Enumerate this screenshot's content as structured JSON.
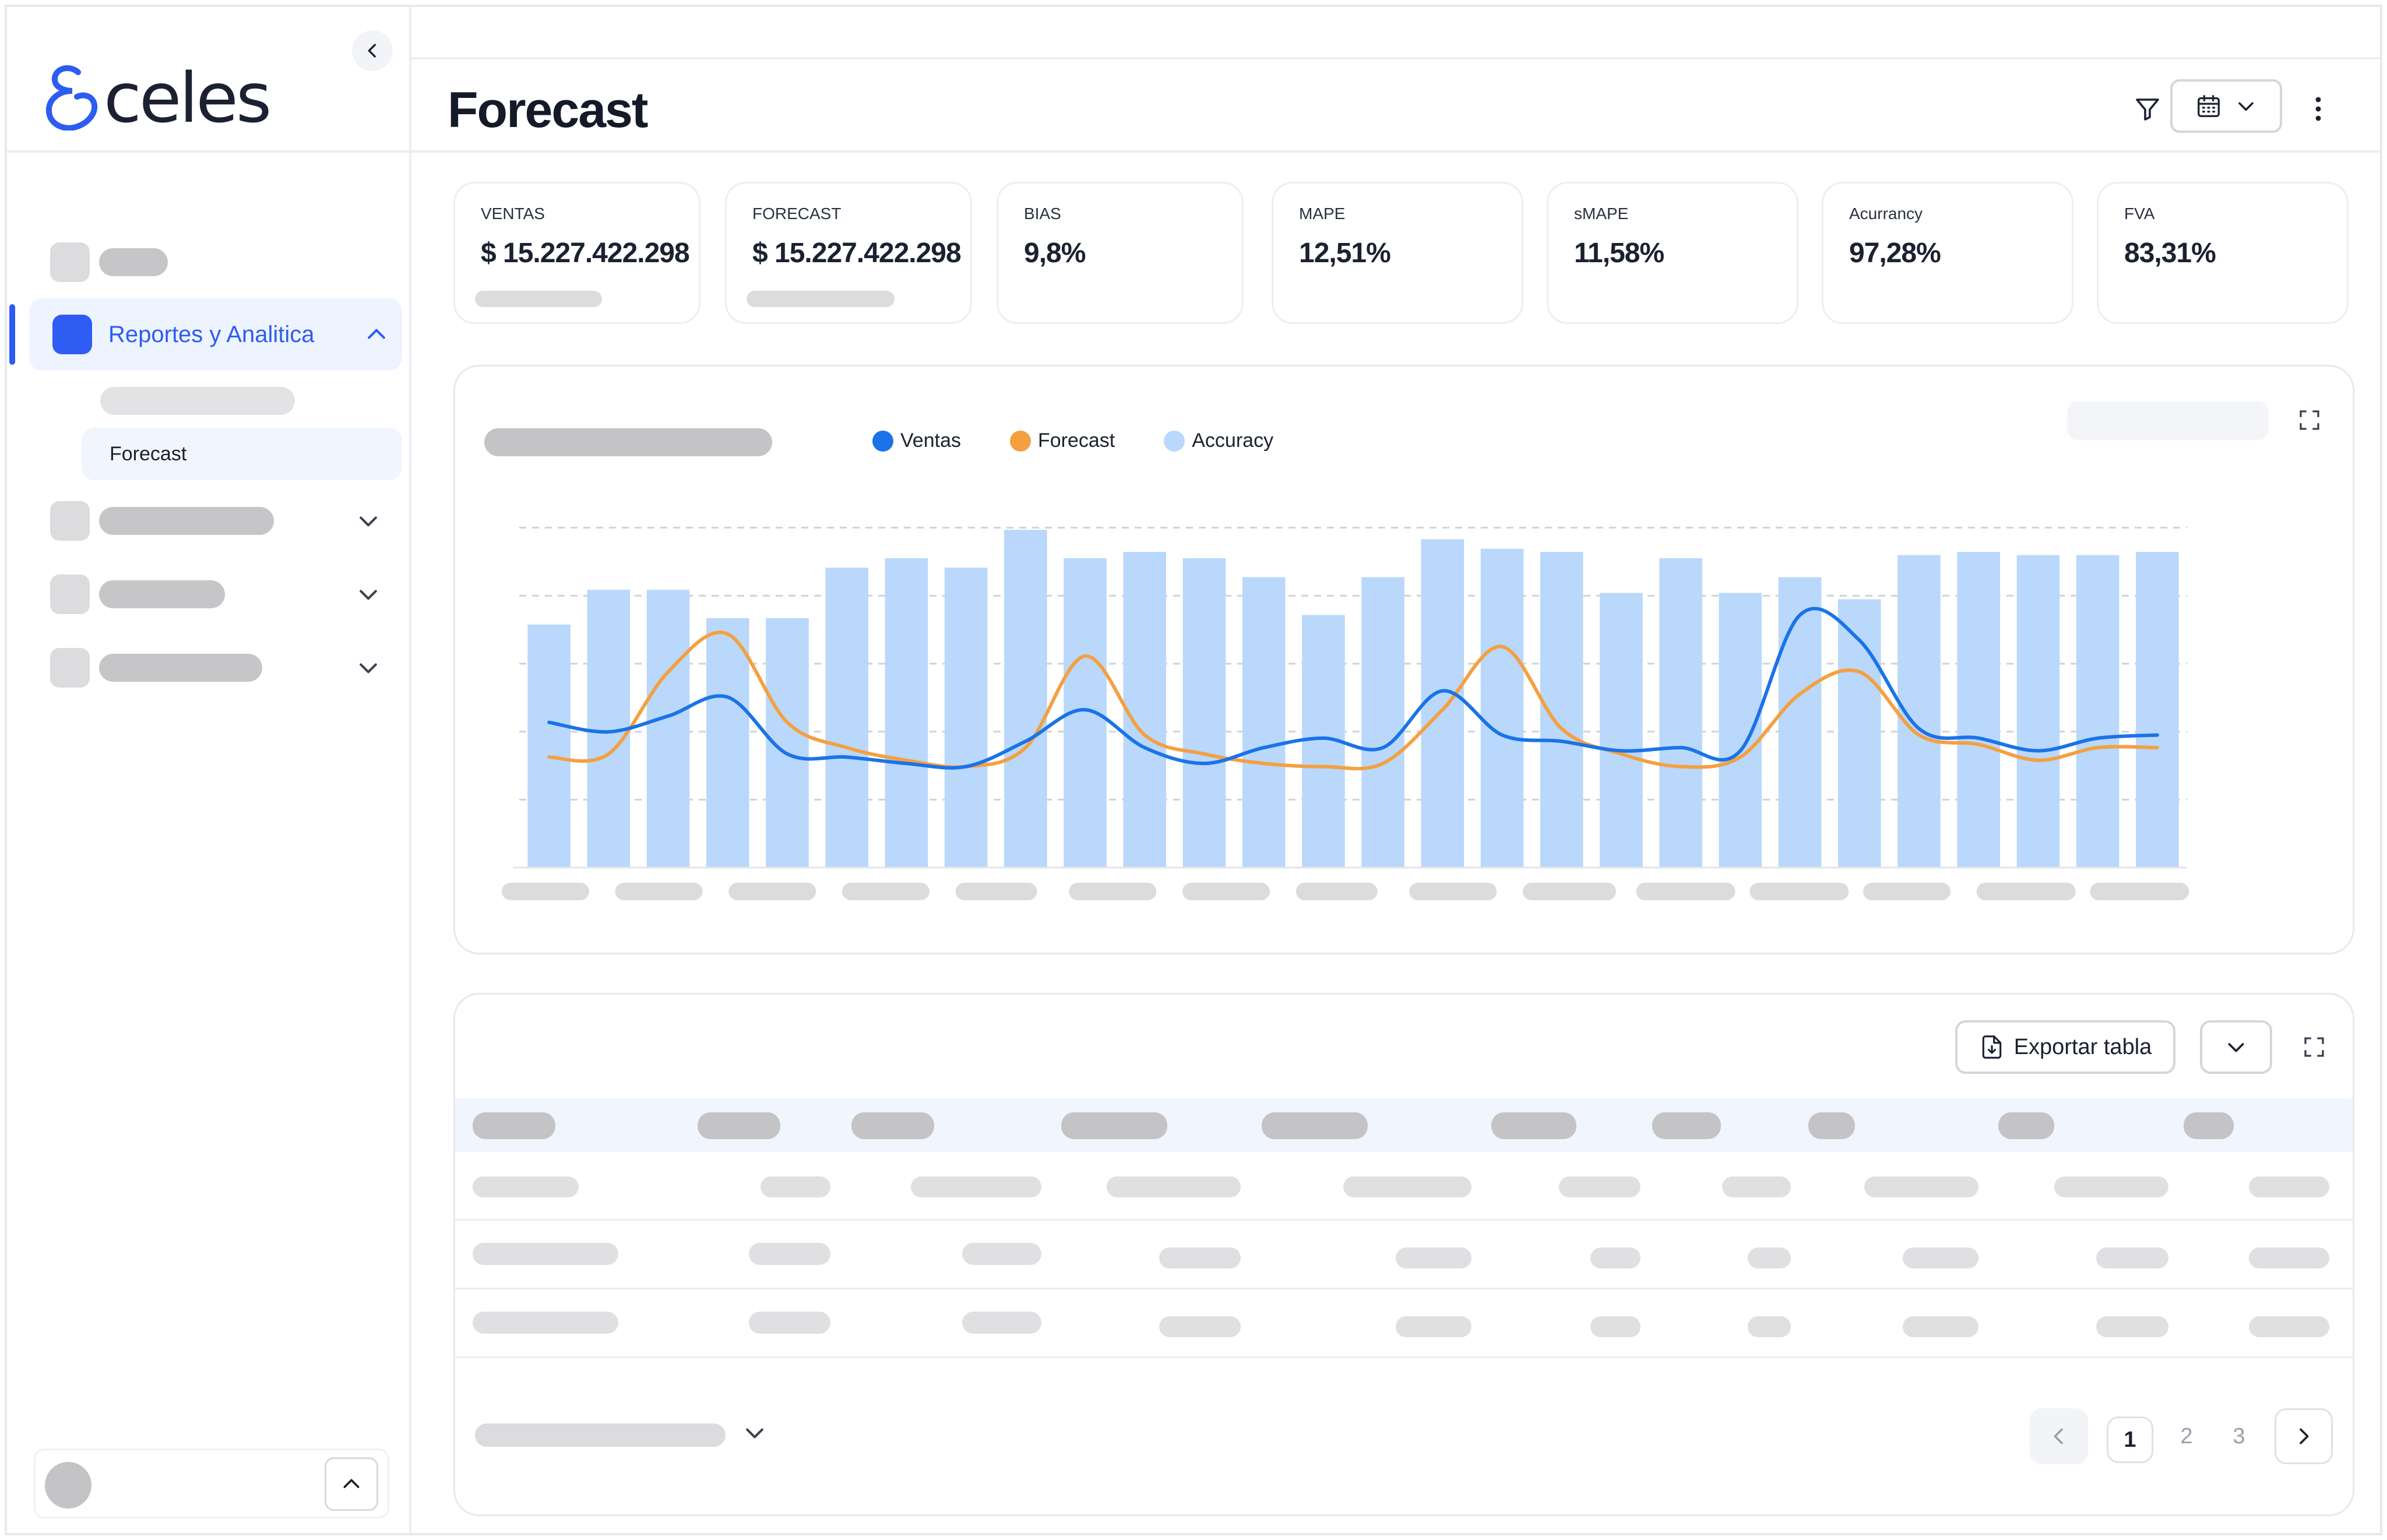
{
  "app": {
    "brand": "celes",
    "accent_color": "#2d5cf0"
  },
  "sidebar": {
    "active_item_label": "Reportes y Analitica",
    "active_sub_item_label": "Forecast"
  },
  "header": {
    "title": "Forecast"
  },
  "kpis": [
    {
      "label": "VENTAS",
      "value": "$ 15.227.422.298"
    },
    {
      "label": "FORECAST",
      "value": "$ 15.227.422.298"
    },
    {
      "label": "BIAS",
      "value": "9,8%"
    },
    {
      "label": "MAPE",
      "value": "12,51%"
    },
    {
      "label": "sMAPE",
      "value": "11,58%"
    },
    {
      "label": "Acurrancy",
      "value": "97,28%"
    },
    {
      "label": "FVA",
      "value": "83,31%"
    }
  ],
  "legend": [
    {
      "name": "Ventas",
      "color": "#1a73e8"
    },
    {
      "name": "Forecast",
      "color": "#f4a040"
    },
    {
      "name": "Accuracy",
      "color": "#b9d8fb"
    }
  ],
  "chart_data": {
    "type": "bar",
    "title": "",
    "xlabel": "",
    "ylabel": "",
    "ylim": [
      0,
      100
    ],
    "grid": true,
    "series": [
      {
        "name": "Accuracy",
        "type": "bar",
        "color": "#b9d8fb",
        "values": [
          77,
          88,
          88,
          79,
          79,
          95,
          98,
          95,
          107,
          98,
          100,
          98,
          92,
          80,
          92,
          104,
          101,
          100,
          87,
          98,
          87,
          92,
          85,
          99,
          100,
          99,
          99,
          100
        ]
      },
      {
        "name": "Ventas",
        "type": "line",
        "color": "#1a73e8",
        "values": [
          46,
          43,
          48,
          54,
          36,
          35,
          33,
          32,
          40,
          50,
          38,
          33,
          38,
          41,
          38,
          56,
          42,
          40,
          37,
          38,
          37,
          80,
          72,
          44,
          41,
          37,
          41,
          42
        ]
      },
      {
        "name": "Forecast",
        "type": "line",
        "color": "#f4a040",
        "values": [
          35,
          36,
          62,
          74,
          46,
          38,
          34,
          32,
          38,
          67,
          42,
          36,
          33,
          32,
          33,
          50,
          70,
          44,
          36,
          32,
          35,
          55,
          62,
          42,
          39,
          34,
          38,
          38
        ]
      }
    ]
  },
  "table": {
    "export_label": "Exportar tabla"
  },
  "pagination": {
    "pages": [
      "1",
      "2",
      "3"
    ],
    "current": "1"
  }
}
